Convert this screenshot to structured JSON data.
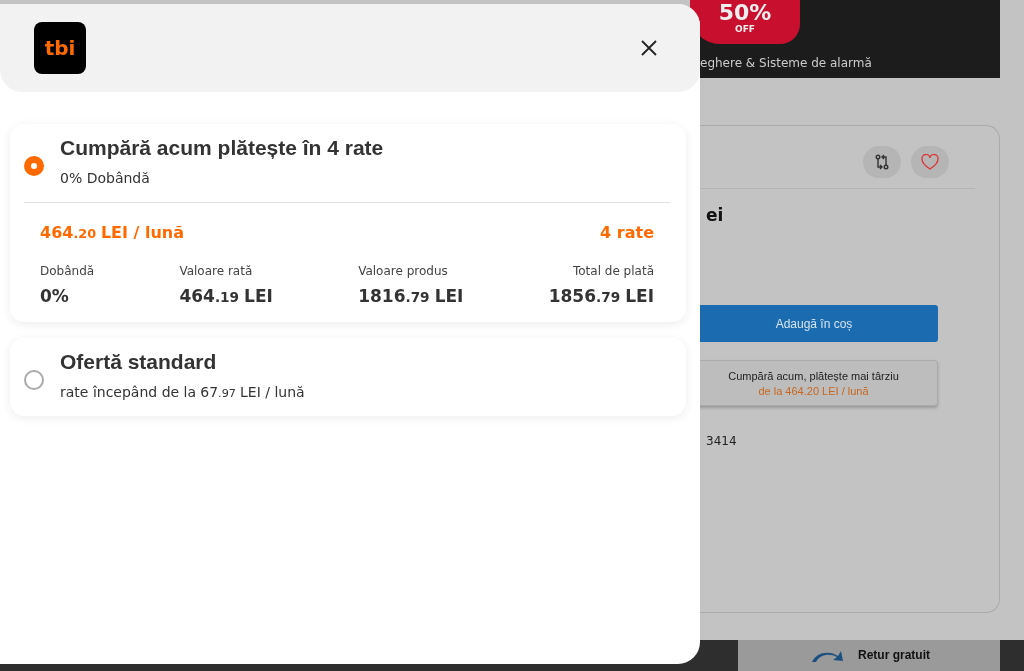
{
  "background_page": {
    "banner": {
      "discount": "50%",
      "discount_label": "OFF",
      "caption": "eghere & Sisteme de alarmă"
    },
    "product_card": {
      "title_fragment": "ei",
      "add_to_cart": "Adaugă în coș",
      "bnpl_button": {
        "title": "Cumpără acum, plătește mai târziu",
        "subtitle": "de la 464.20 LEI / lună"
      },
      "code_fragment": "3414"
    },
    "footer": {
      "return_label": "Retur gratuit"
    }
  },
  "modal": {
    "logo": "tbi",
    "offers": [
      {
        "selected": true,
        "title": "Cumpără acum plătește în 4 rate",
        "subtitle": [
          {
            "kind": "text",
            "text": "0% Dobândă"
          }
        ],
        "monthly": [
          {
            "kind": "int",
            "text": "464"
          },
          {
            "kind": "dec",
            "text": ".20"
          },
          {
            "kind": "unit",
            "text": "LEI / lună"
          }
        ],
        "installments": "4 rate",
        "details": [
          {
            "label": "Dobândă",
            "value": [
              {
                "kind": "int",
                "text": "0%"
              }
            ]
          },
          {
            "label": "Valoare rată",
            "value": [
              {
                "kind": "int",
                "text": "464"
              },
              {
                "kind": "dec",
                "text": ".19"
              },
              {
                "kind": "unit",
                "text": "LEI"
              }
            ]
          },
          {
            "label": "Valoare produs",
            "value": [
              {
                "kind": "int",
                "text": "1816"
              },
              {
                "kind": "dec",
                "text": ".79"
              },
              {
                "kind": "unit",
                "text": "LEI"
              }
            ]
          },
          {
            "label": "Total de plată",
            "value": [
              {
                "kind": "int",
                "text": "1856"
              },
              {
                "kind": "dec",
                "text": ".79"
              },
              {
                "kind": "unit",
                "text": "LEI"
              }
            ]
          }
        ]
      },
      {
        "selected": false,
        "title": "Ofertă standard",
        "subtitle": [
          {
            "kind": "text",
            "text": "rate începând de la"
          },
          {
            "kind": "int",
            "text": "67"
          },
          {
            "kind": "dec",
            "text": ".97"
          },
          {
            "kind": "unit",
            "text": "LEI / lună"
          }
        ]
      }
    ]
  }
}
